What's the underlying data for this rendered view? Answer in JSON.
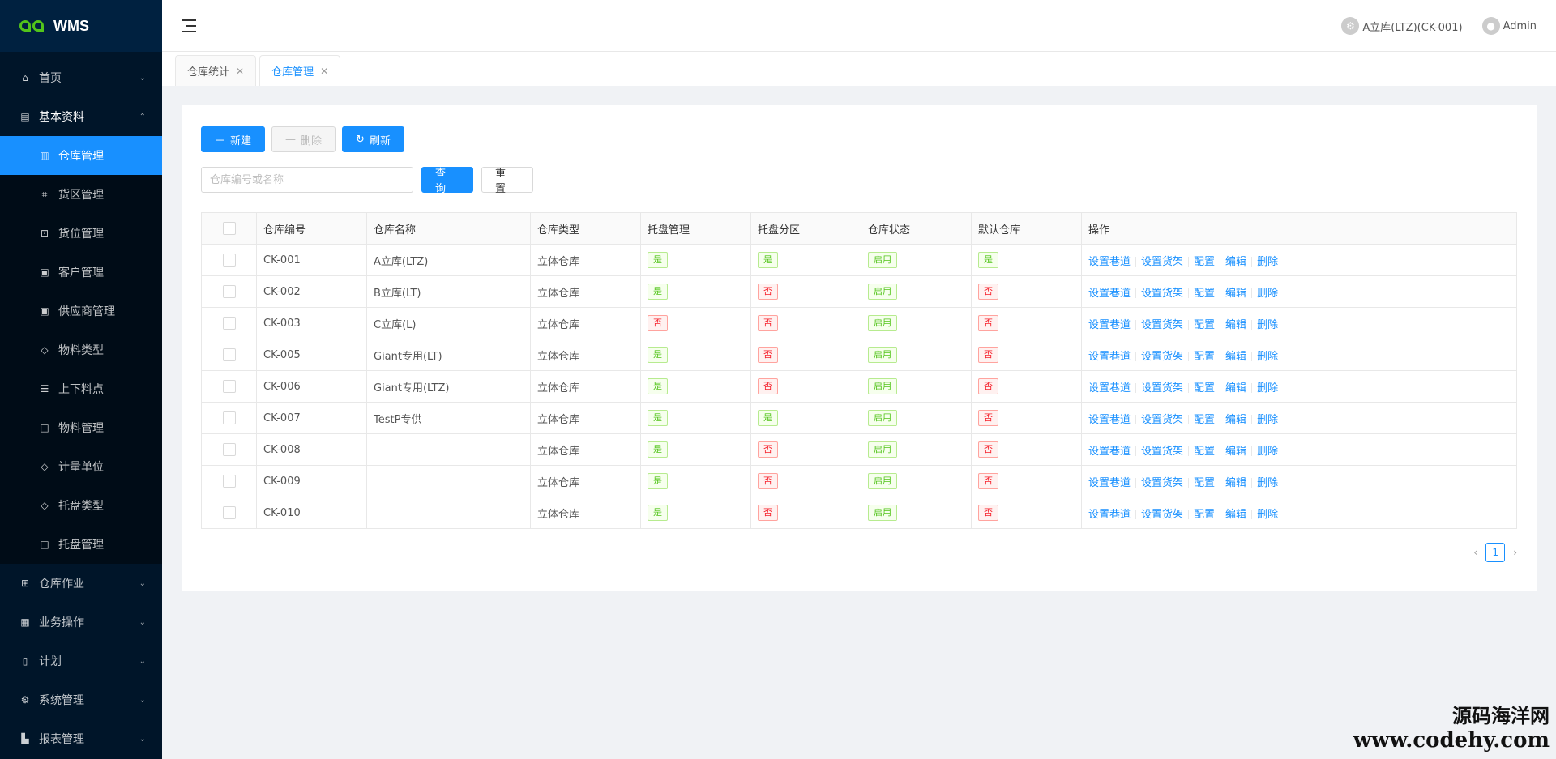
{
  "app": {
    "logo_text": "WMS"
  },
  "header": {
    "warehouse": "A立库(LTZ)(CK-001)",
    "user": "Admin"
  },
  "sidebar": {
    "items": [
      {
        "label": "首页",
        "icon": "home-icon"
      },
      {
        "label": "基本资料",
        "icon": "book-icon"
      },
      {
        "label": "仓库作业",
        "icon": "grid-icon"
      },
      {
        "label": "业务操作",
        "icon": "clipboard-icon"
      },
      {
        "label": "计划",
        "icon": "file-icon"
      },
      {
        "label": "系统管理",
        "icon": "gear-icon"
      },
      {
        "label": "报表管理",
        "icon": "chart-icon"
      }
    ],
    "sub_items": [
      {
        "label": "仓库管理",
        "icon": "list-icon"
      },
      {
        "label": "货区管理",
        "icon": "area-icon"
      },
      {
        "label": "货位管理",
        "icon": "lock-icon"
      },
      {
        "label": "客户管理",
        "icon": "id-card-icon"
      },
      {
        "label": "供应商管理",
        "icon": "id-card-icon"
      },
      {
        "label": "物料类型",
        "icon": "tag-icon"
      },
      {
        "label": "上下料点",
        "icon": "rows-icon"
      },
      {
        "label": "物料管理",
        "icon": "box-icon"
      },
      {
        "label": "计量单位",
        "icon": "tag-icon"
      },
      {
        "label": "托盘类型",
        "icon": "tag-icon"
      },
      {
        "label": "托盘管理",
        "icon": "box-icon"
      }
    ]
  },
  "tabs": [
    {
      "label": "仓库统计"
    },
    {
      "label": "仓库管理"
    }
  ],
  "toolbar": {
    "new_label": "新建",
    "delete_label": "删除",
    "refresh_label": "刷新"
  },
  "search": {
    "placeholder": "仓库编号或名称",
    "query_label": "查 询",
    "reset_label": "重 置"
  },
  "table": {
    "columns": [
      "仓库编号",
      "仓库名称",
      "仓库类型",
      "托盘管理",
      "托盘分区",
      "仓库状态",
      "默认仓库",
      "操作"
    ],
    "rows": [
      {
        "code": "CK-001",
        "name": "A立库(LTZ)",
        "type": "立体仓库",
        "pallet": "是",
        "zone": "是",
        "status": "启用",
        "default": "是"
      },
      {
        "code": "CK-002",
        "name": "B立库(LT)",
        "type": "立体仓库",
        "pallet": "是",
        "zone": "否",
        "status": "启用",
        "default": "否"
      },
      {
        "code": "CK-003",
        "name": "C立库(L)",
        "type": "立体仓库",
        "pallet": "否",
        "zone": "否",
        "status": "启用",
        "default": "否"
      },
      {
        "code": "CK-005",
        "name": "Giant专用(LT)",
        "type": "立体仓库",
        "pallet": "是",
        "zone": "否",
        "status": "启用",
        "default": "否"
      },
      {
        "code": "CK-006",
        "name": "Giant专用(LTZ)",
        "type": "立体仓库",
        "pallet": "是",
        "zone": "否",
        "status": "启用",
        "default": "否"
      },
      {
        "code": "CK-007",
        "name": "TestP专供",
        "type": "立体仓库",
        "pallet": "是",
        "zone": "是",
        "status": "启用",
        "default": "否"
      },
      {
        "code": "CK-008",
        "name": "",
        "type": "立体仓库",
        "pallet": "是",
        "zone": "否",
        "status": "启用",
        "default": "否"
      },
      {
        "code": "CK-009",
        "name": "",
        "type": "立体仓库",
        "pallet": "是",
        "zone": "否",
        "status": "启用",
        "default": "否"
      },
      {
        "code": "CK-010",
        "name": "",
        "type": "立体仓库",
        "pallet": "是",
        "zone": "否",
        "status": "启用",
        "default": "否"
      }
    ],
    "actions": [
      "设置巷道",
      "设置货架",
      "配置",
      "编辑",
      "删除"
    ]
  },
  "pagination": {
    "current": "1"
  },
  "watermark": {
    "line1": "源码海洋网",
    "line2": "www.codehy.com"
  }
}
